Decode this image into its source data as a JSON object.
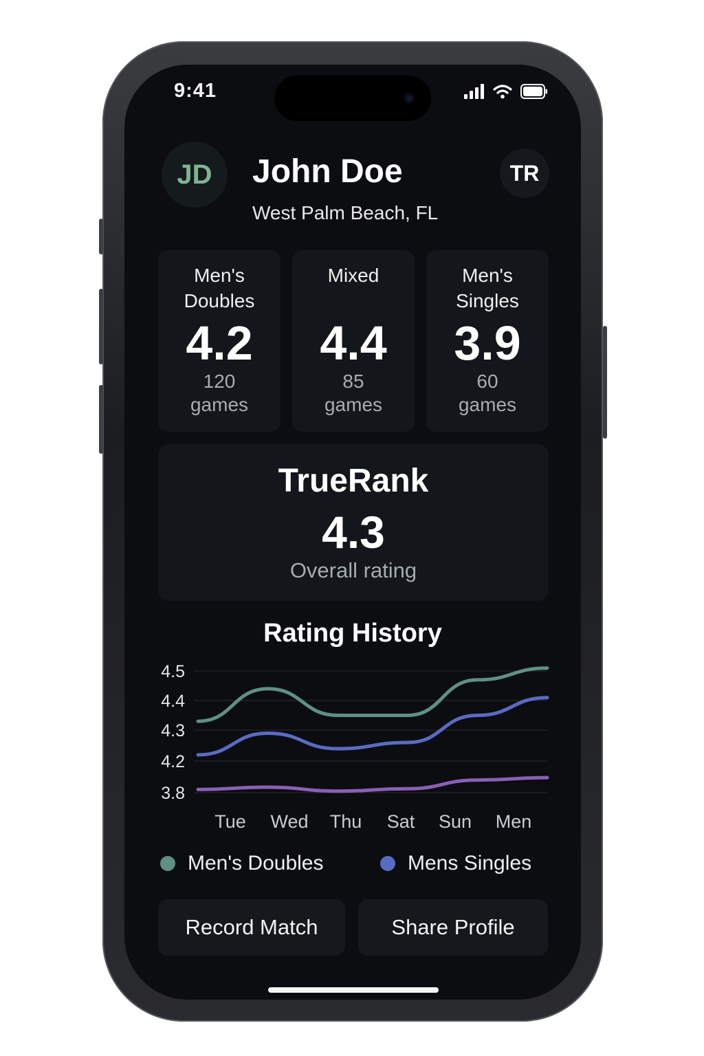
{
  "status_bar": {
    "time": "9:41",
    "icons": [
      "signal-icon",
      "wifi-icon",
      "battery-icon"
    ]
  },
  "profile": {
    "initials": "JD",
    "name": "John Doe",
    "location": "West Palm Beach, FL",
    "badge": "TR"
  },
  "ratings": [
    {
      "title_line1": "Men's",
      "title_line2": "Doubles",
      "value": "4.2",
      "games_count": "120",
      "games_label": "games"
    },
    {
      "title_line1": "Mixed",
      "title_line2": "",
      "value": "4.4",
      "games_count": "85",
      "games_label": "games"
    },
    {
      "title_line1": "Men's",
      "title_line2": "Singles",
      "value": "3.9",
      "games_count": "60",
      "games_label": "games"
    }
  ],
  "truerank": {
    "title": "TrueRank",
    "value": "4.3",
    "subtitle": "Overall rating"
  },
  "history": {
    "title": "Rating History"
  },
  "chart_data": {
    "type": "line",
    "title": "Rating History",
    "categories": [
      "Tue",
      "Wed",
      "Thu",
      "Sat",
      "Sun",
      "Men"
    ],
    "y_tick_labels": [
      "4.5",
      "4.4",
      "4.3",
      "4.2",
      "3.8"
    ],
    "grid": true,
    "legend_position": "bottom",
    "series": [
      {
        "name": "Men's Doubles",
        "color": "#5f8f86",
        "values": [
          4.33,
          4.44,
          4.35,
          4.35,
          4.47,
          4.51
        ]
      },
      {
        "name": "Mens Singles",
        "color": "#5a6bc2",
        "values": [
          4.22,
          4.29,
          4.24,
          4.26,
          4.35,
          4.41
        ]
      },
      {
        "name": "",
        "color": "#8a5fb6",
        "values": [
          3.84,
          3.87,
          3.82,
          3.85,
          3.96,
          3.99
        ]
      }
    ]
  },
  "legend": [
    {
      "label": "Men's Doubles",
      "color": "#5f8f86"
    },
    {
      "label": "Mens Singles",
      "color": "#5a6bc2"
    }
  ],
  "actions": {
    "record_label": "Record Match",
    "share_label": "Share Profile"
  }
}
